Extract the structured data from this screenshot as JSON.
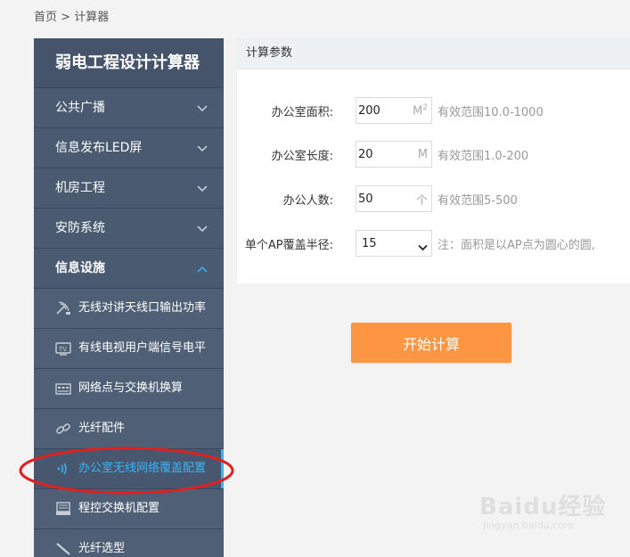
{
  "breadcrumb": {
    "home": "首页",
    "sep": ">",
    "current": "计算器"
  },
  "sidebar": {
    "title": "弱电工程设计计算器",
    "items": [
      {
        "label": "公共广播",
        "expanded": false
      },
      {
        "label": "信息发布LED屏",
        "expanded": false
      },
      {
        "label": "机房工程",
        "expanded": false
      },
      {
        "label": "安防系统",
        "expanded": false
      },
      {
        "label": "信息设施",
        "expanded": true
      }
    ],
    "subitems": [
      {
        "label": "无线对讲天线口输出功率",
        "icon": "wireless-antenna-icon"
      },
      {
        "label": "有线电视用户端信号电平",
        "icon": "tv-icon"
      },
      {
        "label": "网络点与交换机换算",
        "icon": "switch-icon"
      },
      {
        "label": "光纤配件",
        "icon": "link-icon"
      },
      {
        "label": "办公室无线网络覆盖配置",
        "icon": "wifi-signal-icon",
        "active": true
      },
      {
        "label": "程控交换机配置",
        "icon": "pbx-icon"
      },
      {
        "label": "光纤选型",
        "icon": "fiber-icon"
      }
    ]
  },
  "panel": {
    "title": "计算参数",
    "fields": {
      "area": {
        "label": "办公室面积:",
        "value": "200",
        "unit": "M",
        "unit_sup": "2",
        "hint": "有效范围10.0-1000"
      },
      "length": {
        "label": "办公室长度:",
        "value": "20",
        "unit": "M",
        "hint": "有效范围1.0-200"
      },
      "people": {
        "label": "办公人数:",
        "value": "50",
        "unit": "个",
        "hint": "有效范围5-500"
      },
      "radius": {
        "label": "单个AP覆盖半径:",
        "value": "15",
        "hint": "注：面积是以AP点为圆心的圆,"
      }
    },
    "calc_button": "开始计算"
  },
  "watermark": {
    "brand": "Baidu经验",
    "domain": "jingyan.baidu.com"
  },
  "colors": {
    "sidebar": "#45546a",
    "accent": "#3ab4f2",
    "button": "#fc9643",
    "annotation": "#e0201e"
  }
}
